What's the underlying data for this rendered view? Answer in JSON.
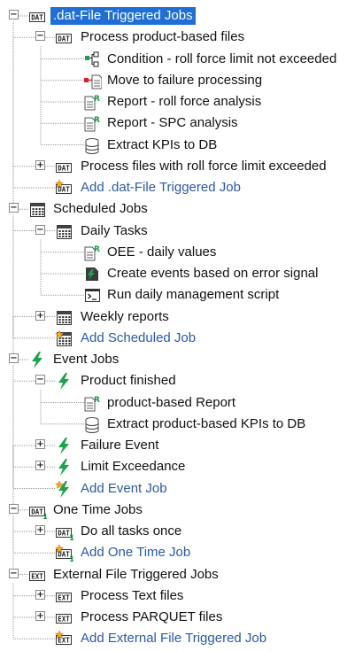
{
  "colors": {
    "selection": "#1f6fd6",
    "add_link": "#2b5aa8",
    "event_icon": "#1aa34a",
    "condition_icon": "#1aa34a",
    "failure_icon": "#d9232e"
  },
  "tree": [
    {
      "label": ".dat-File Triggered Jobs",
      "icon": "dat-icon",
      "depth": 0,
      "toggle": "-",
      "selected": true
    },
    {
      "label": "Process product-based files",
      "icon": "dat-icon",
      "depth": 1,
      "toggle": "-"
    },
    {
      "label": "Condition - roll force limit not exceeded",
      "icon": "condition-icon",
      "depth": 2
    },
    {
      "label": "Move to failure processing",
      "icon": "failure-move-icon",
      "depth": 2
    },
    {
      "label": "Report - roll force analysis",
      "icon": "report-icon",
      "depth": 2
    },
    {
      "label": "Report - SPC analysis",
      "icon": "report-icon",
      "depth": 2
    },
    {
      "label": "Extract KPIs to DB",
      "icon": "database-icon",
      "depth": 2
    },
    {
      "label": "Process files with roll force limit exceeded",
      "icon": "dat-icon",
      "depth": 1,
      "toggle": "+"
    },
    {
      "label": "Add .dat-File Triggered Job",
      "icon": "dat-add-icon",
      "depth": 1,
      "add": true
    },
    {
      "label": "Scheduled Jobs",
      "icon": "calendar-icon",
      "depth": 0,
      "toggle": "-"
    },
    {
      "label": "Daily Tasks",
      "icon": "calendar-icon",
      "depth": 1,
      "toggle": "-"
    },
    {
      "label": "OEE - daily values",
      "icon": "report-icon",
      "depth": 2
    },
    {
      "label": "Create events based on error signal",
      "icon": "event-create-icon",
      "depth": 2
    },
    {
      "label": "Run daily management script",
      "icon": "script-icon",
      "depth": 2
    },
    {
      "label": "Weekly reports",
      "icon": "calendar-icon",
      "depth": 1,
      "toggle": "+"
    },
    {
      "label": "Add Scheduled Job",
      "icon": "calendar-add-icon",
      "depth": 1,
      "add": true
    },
    {
      "label": "Event Jobs",
      "icon": "lightning-icon",
      "depth": 0,
      "toggle": "-"
    },
    {
      "label": "Product finished",
      "icon": "lightning-icon",
      "depth": 1,
      "toggle": "-"
    },
    {
      "label": "product-based Report",
      "icon": "report-icon",
      "depth": 2
    },
    {
      "label": "Extract product-based KPIs to DB",
      "icon": "database-icon",
      "depth": 2
    },
    {
      "label": "Failure Event",
      "icon": "lightning-icon",
      "depth": 1,
      "toggle": "+"
    },
    {
      "label": "Limit Exceedance",
      "icon": "lightning-icon",
      "depth": 1,
      "toggle": "+"
    },
    {
      "label": "Add Event Job",
      "icon": "lightning-add-icon",
      "depth": 1,
      "add": true
    },
    {
      "label": "One Time Jobs",
      "icon": "dat1-icon",
      "depth": 0,
      "toggle": "-"
    },
    {
      "label": "Do all tasks once",
      "icon": "dat1-icon",
      "depth": 1,
      "toggle": "+"
    },
    {
      "label": "Add One Time Job",
      "icon": "dat1-add-icon",
      "depth": 1,
      "add": true
    },
    {
      "label": "External File Triggered Jobs",
      "icon": "ext-icon",
      "depth": 0,
      "toggle": "-"
    },
    {
      "label": "Process Text  files",
      "icon": "ext-icon",
      "depth": 1,
      "toggle": "+"
    },
    {
      "label": "Process PARQUET files",
      "icon": "ext-icon",
      "depth": 1,
      "toggle": "+"
    },
    {
      "label": "Add External File Triggered Job",
      "icon": "ext-add-icon",
      "depth": 1,
      "add": true
    }
  ]
}
